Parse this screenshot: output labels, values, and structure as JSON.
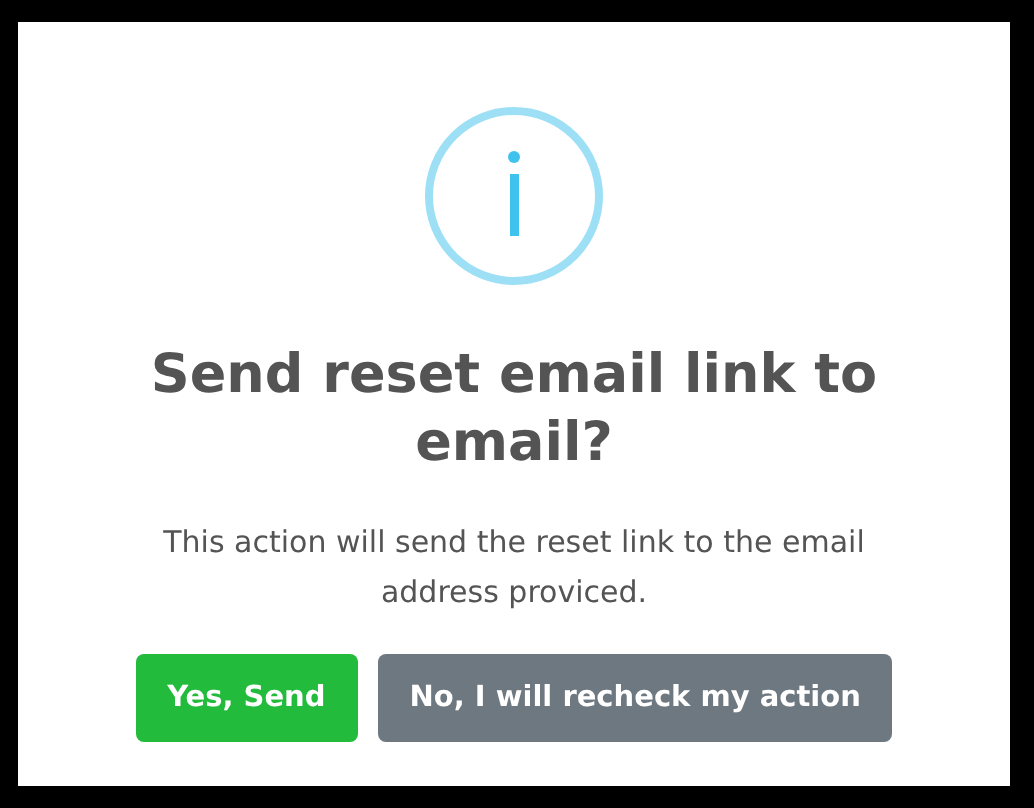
{
  "dialog": {
    "title": "Send reset email link to email?",
    "message": "This action will send the reset link to the email address proviced.",
    "buttons": [
      {
        "label": "Yes, Send",
        "kind": "confirm"
      },
      {
        "label": "No, I will recheck my action",
        "kind": "cancel"
      }
    ]
  }
}
